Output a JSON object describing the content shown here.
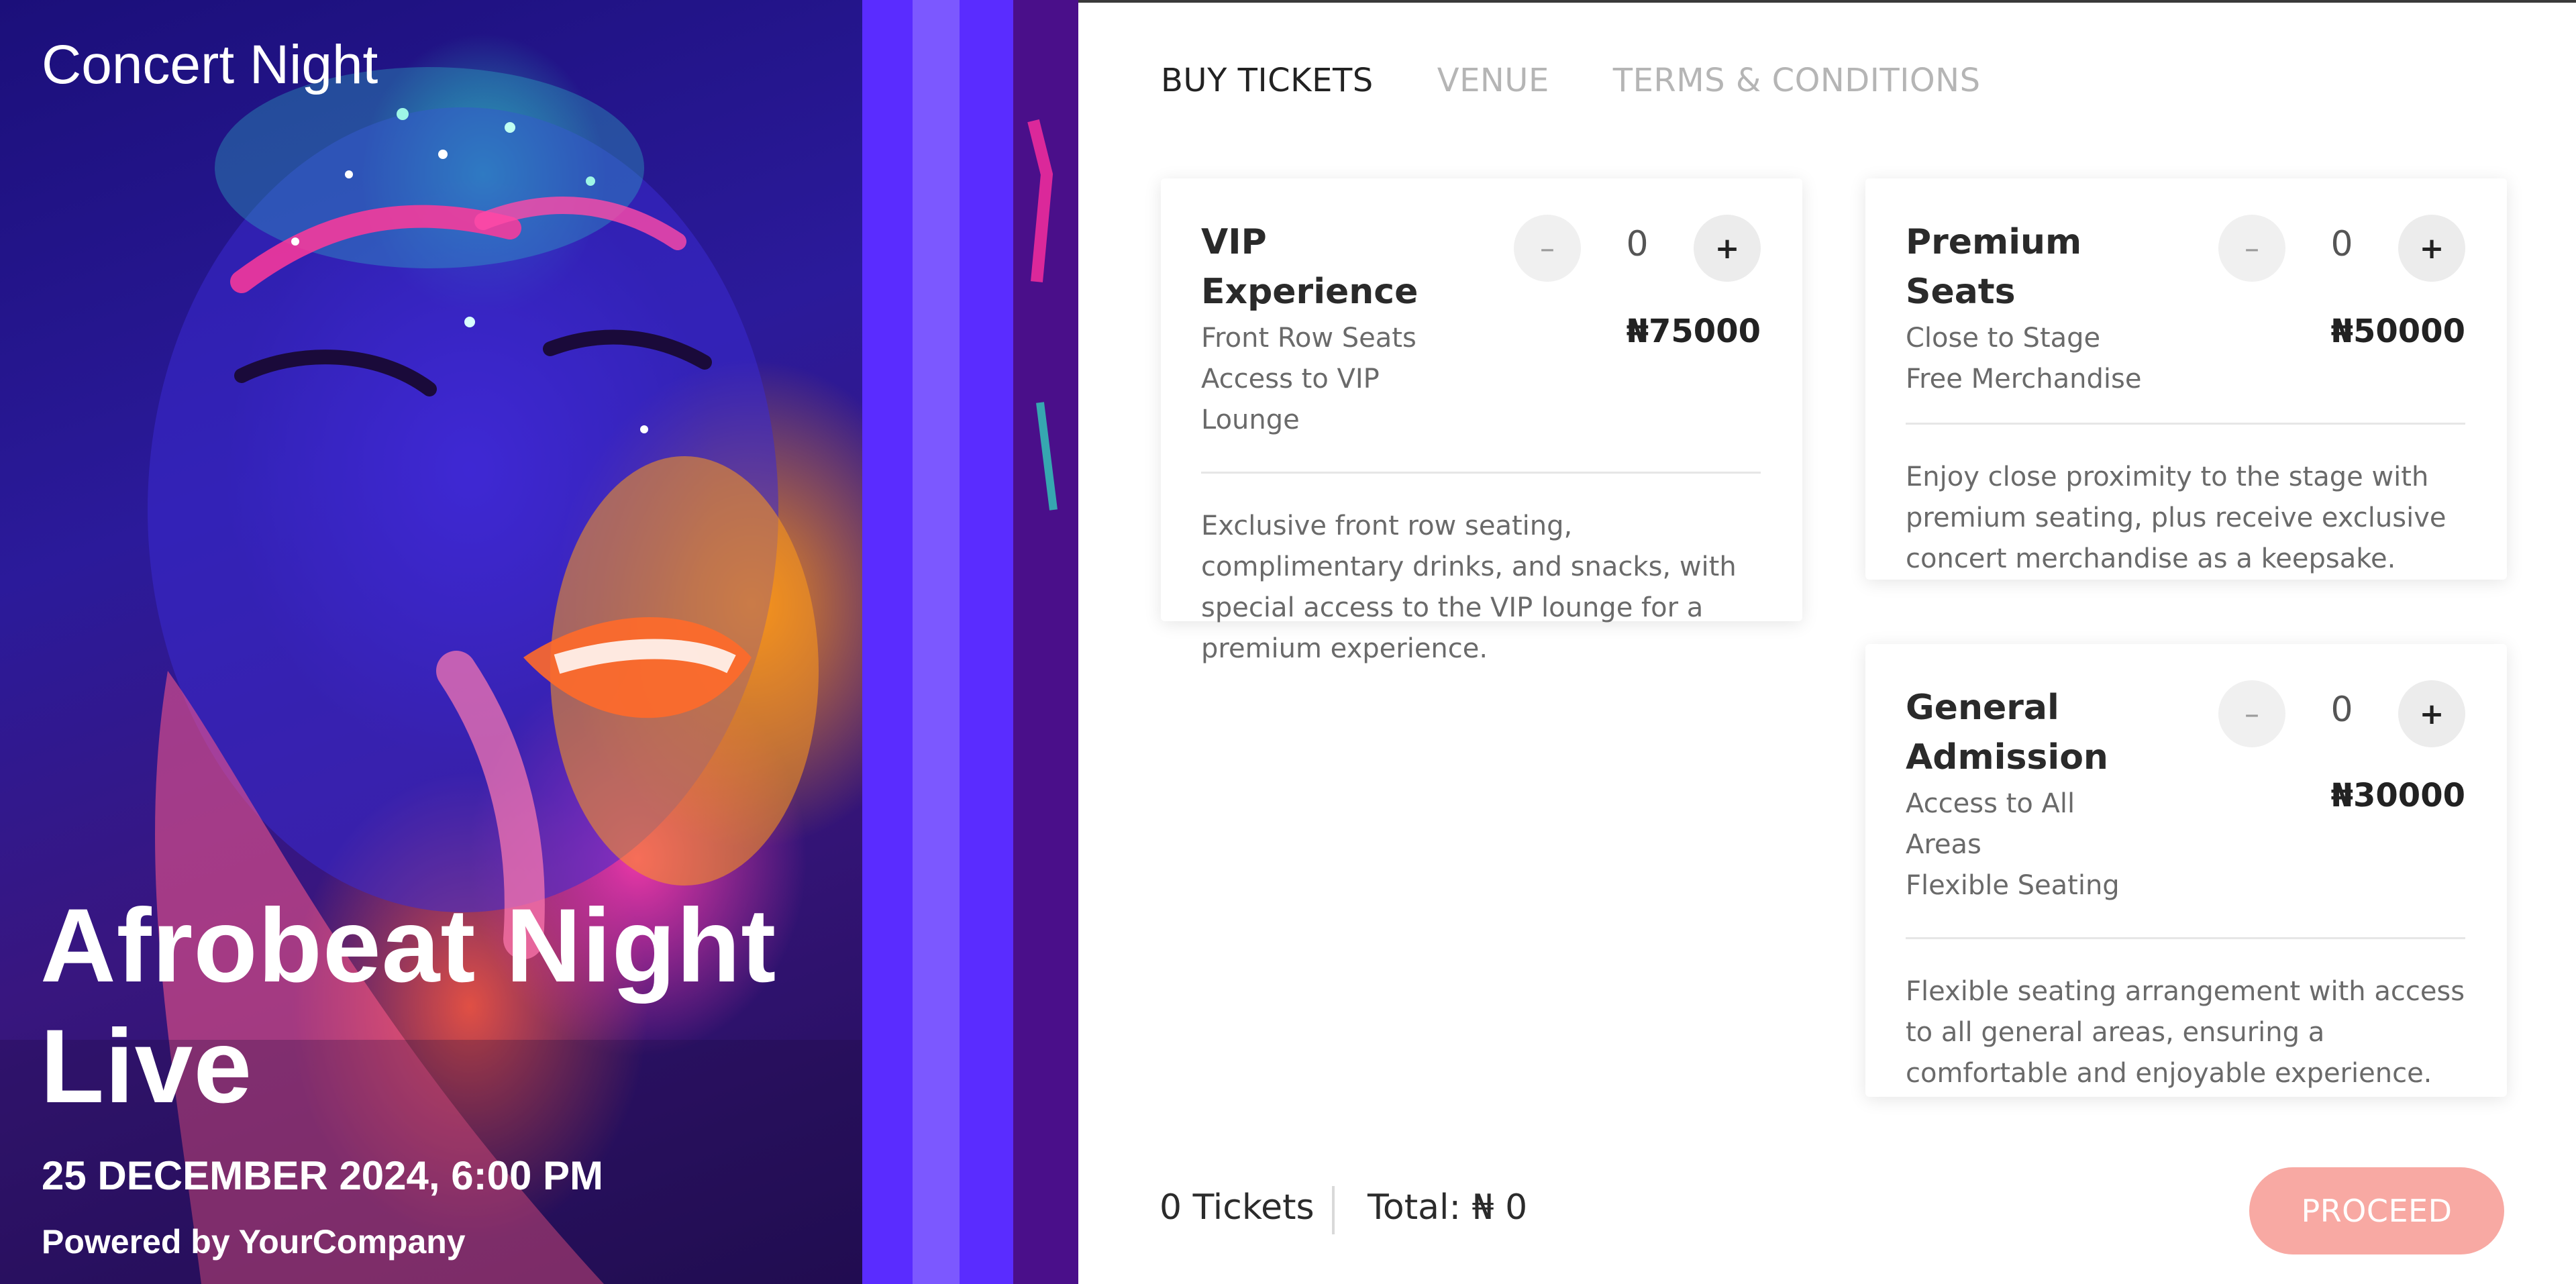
{
  "hero": {
    "brand": "Concert Night",
    "headline": "Afrobeat Night Live",
    "date": "25 DECEMBER 2024, 6:00 PM",
    "powered_by": "Powered by YourCompany"
  },
  "tabs": [
    {
      "label": "BUY TICKETS",
      "active": true
    },
    {
      "label": "VENUE",
      "active": false
    },
    {
      "label": "TERMS & CONDITIONS",
      "active": false
    }
  ],
  "tickets": {
    "vip": {
      "title": "VIP Experience",
      "features": [
        "Front Row Seats",
        "Access to VIP",
        "Lounge"
      ],
      "quantity": "0",
      "price": "₦75000",
      "description": "Exclusive front row seating, complimentary drinks, and snacks, with special access to the VIP lounge for a premium experience.",
      "minus": "–",
      "plus": "+"
    },
    "premium": {
      "title": "Premium Seats",
      "features": [
        "Close to Stage",
        "Free Merchandise"
      ],
      "quantity": "0",
      "price": "₦50000",
      "description": "Enjoy close proximity to the stage with premium seating, plus receive exclusive concert merchandise as a keepsake.",
      "minus": "–",
      "plus": "+"
    },
    "general": {
      "title": "General Admission",
      "features": [
        "Access to All Areas",
        "Flexible Seating"
      ],
      "quantity": "0",
      "price": "₦30000",
      "description": "Flexible seating arrangement with access to all general areas, ensuring a comfortable and enjoyable experience.",
      "minus": "–",
      "plus": "+"
    }
  },
  "footer": {
    "ticket_count": "0 Tickets",
    "total": "Total: ₦ 0",
    "proceed_label": "PROCEED"
  },
  "colors": {
    "proceed_button": "#f8a9a3",
    "tab_active": "#222222",
    "tab_inactive": "#b5b5b5"
  }
}
